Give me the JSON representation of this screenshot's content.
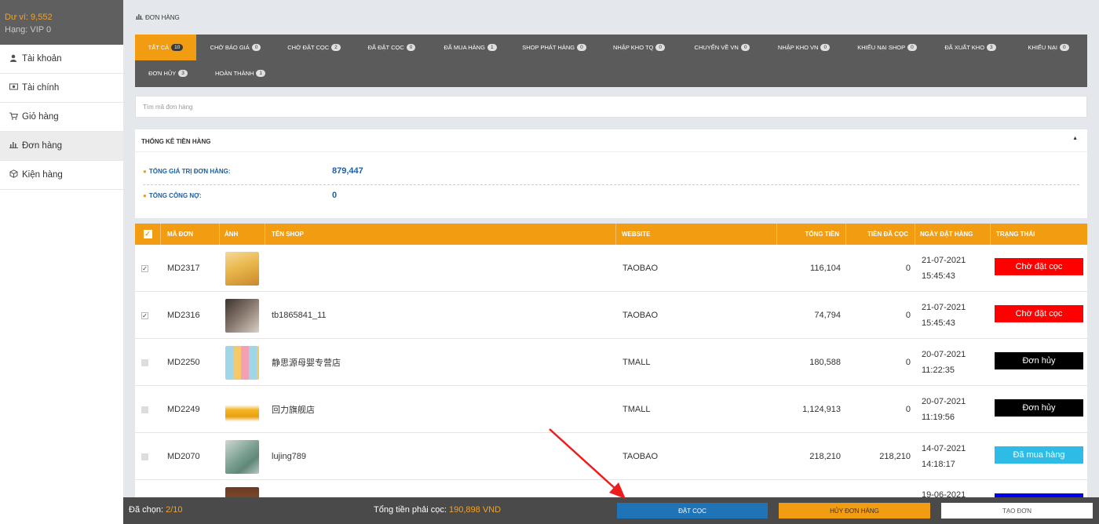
{
  "account": {
    "balance": "Dư ví: 9,552",
    "rank": "Hạng: VIP 0"
  },
  "sidebar": {
    "items": [
      {
        "label": "Tài khoản",
        "icon": "user-icon"
      },
      {
        "label": "Tài chính",
        "icon": "money-icon"
      },
      {
        "label": "Giỏ hàng",
        "icon": "cart-icon"
      },
      {
        "label": "Đơn hàng",
        "icon": "chart-bar-icon",
        "active": true
      },
      {
        "label": "Kiện hàng",
        "icon": "package-icon"
      }
    ]
  },
  "breadcrumb": {
    "label": "ĐƠN HÀNG"
  },
  "tabs": [
    {
      "label": "TẤT CẢ",
      "count": "10",
      "active": true
    },
    {
      "label": "CHỜ BÁO GIÁ",
      "count": "0"
    },
    {
      "label": "CHỜ ĐẶT CỌC",
      "count": "2"
    },
    {
      "label": "ĐÃ ĐẶT CỌC",
      "count": "0"
    },
    {
      "label": "ĐÃ MUA HÀNG",
      "count": "1"
    },
    {
      "label": "SHOP PHÁT HÀNG",
      "count": "0"
    },
    {
      "label": "NHẬP KHO TQ",
      "count": "0"
    },
    {
      "label": "CHUYỂN VỀ VN",
      "count": "0"
    },
    {
      "label": "NHẬP KHO VN",
      "count": "0"
    },
    {
      "label": "KHIẾU NẠI SHOP",
      "count": "0"
    },
    {
      "label": "ĐÃ XUẤT KHO",
      "count": "3"
    },
    {
      "label": "KHIẾU NẠI",
      "count": "0"
    },
    {
      "label": "ĐƠN HỦY",
      "count": "3"
    },
    {
      "label": "HOÀN THÀNH",
      "count": "1"
    }
  ],
  "search": {
    "placeholder": "Tìm mã đơn hàng"
  },
  "stats": {
    "title": "THỐNG KÊ TIỀN HÀNG",
    "total_label": "TỔNG GIÁ TRỊ ĐƠN HÀNG:",
    "total_value": "879,447",
    "debt_label": "TỔNG CÔNG NỢ:",
    "debt_value": "0"
  },
  "table": {
    "headers": {
      "code": "MÃ ĐƠN",
      "image": "ẢNH",
      "shop": "TÊN SHOP",
      "website": "WEBSITE",
      "total": "TỔNG TIỀN",
      "deposit": "TIỀN ĐÃ CỌC",
      "date": "NGÀY ĐẶT HÀNG",
      "status": "TRẠNG THÁI"
    },
    "rows": [
      {
        "checked": true,
        "code": "MD2317",
        "shop": "",
        "website": "TAOBAO",
        "total": "116,104",
        "deposit": "0",
        "date": "21-07-2021",
        "time": "15:45:43",
        "status": "Chờ đặt cọc",
        "status_color": "#ff0000"
      },
      {
        "checked": true,
        "code": "MD2316",
        "shop": "tb1865841_11",
        "website": "TAOBAO",
        "total": "74,794",
        "deposit": "0",
        "date": "21-07-2021",
        "time": "15:45:43",
        "status": "Chờ đặt cọc",
        "status_color": "#ff0000"
      },
      {
        "checked": false,
        "code": "MD2250",
        "shop": "静思源母婴专营店",
        "website": "TMALL",
        "total": "180,588",
        "deposit": "0",
        "date": "20-07-2021",
        "time": "11:22:35",
        "status": "Đơn hủy",
        "status_color": "#000000"
      },
      {
        "checked": false,
        "code": "MD2249",
        "shop": "回力旗舰店",
        "website": "TMALL",
        "total": "1,124,913",
        "deposit": "0",
        "date": "20-07-2021",
        "time": "11:19:56",
        "status": "Đơn hủy",
        "status_color": "#000000"
      },
      {
        "checked": false,
        "code": "MD2070",
        "shop": "lujing789",
        "website": "TAOBAO",
        "total": "218,210",
        "deposit": "218,210",
        "date": "14-07-2021",
        "time": "14:18:17",
        "status": "Đã mua hàng",
        "status_color": "#2ebce6"
      },
      {
        "checked": false,
        "code": "",
        "shop": "",
        "website": "",
        "total": "",
        "deposit": "",
        "date": "19-06-2021",
        "time": "",
        "status": "",
        "status_color": "#0000ee"
      }
    ]
  },
  "bottom": {
    "selected_label": "Đã chọn:",
    "selected_value": "2/10",
    "total_label": "Tổng tiền phải cọc:",
    "total_value": "190,898 VND",
    "deposit_button": "ĐẶT CỌC",
    "cancel_button": "HỦY ĐƠN HÀNG",
    "create_button": "TẠO ĐƠN"
  },
  "colors": {
    "accent": "#f29c11",
    "tab_bar": "#5b5b5b",
    "deposit_button": "#1f74b8",
    "cancel_button": "#f29c11",
    "annotation_arrow": "#ee1c1c"
  }
}
